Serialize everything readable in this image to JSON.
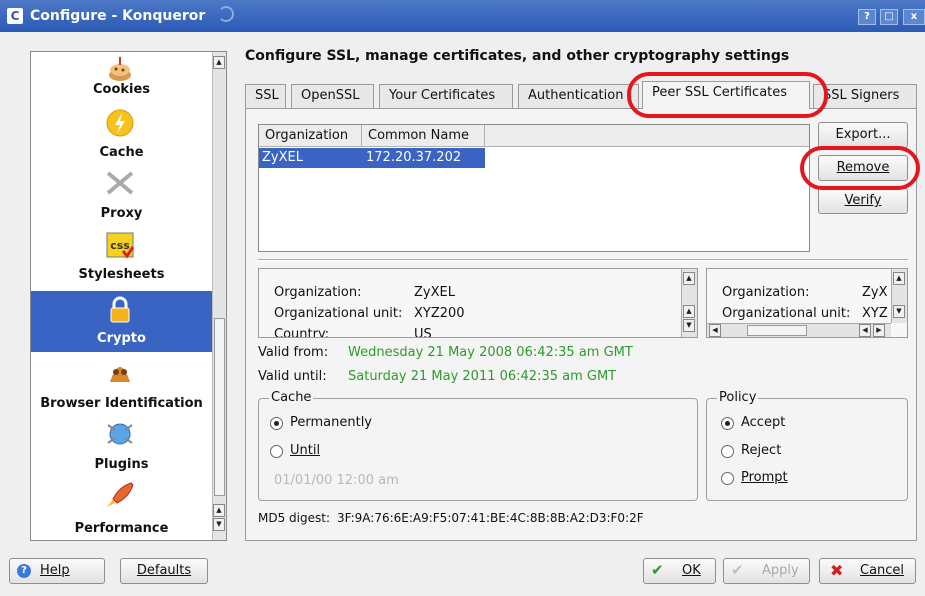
{
  "window": {
    "title": "Configure - Konqueror",
    "app_icon": "C",
    "help_btn": "?",
    "max_btn": "□",
    "close_btn": "x"
  },
  "sidebar": {
    "items": [
      {
        "label": "Cookies",
        "icon": "cookie-icon"
      },
      {
        "label": "Cache",
        "icon": "cache-icon"
      },
      {
        "label": "Proxy",
        "icon": "proxy-icon"
      },
      {
        "label": "Stylesheets",
        "icon": "css-icon"
      },
      {
        "label": "Crypto",
        "icon": "lock-icon",
        "selected": true
      },
      {
        "label": "Browser Identification",
        "icon": "browser-id-icon"
      },
      {
        "label": "Plugins",
        "icon": "plugins-icon"
      },
      {
        "label": "Performance",
        "icon": "rocket-icon"
      }
    ]
  },
  "main": {
    "heading": "Configure SSL, manage certificates, and other cryptography settings",
    "tabs": [
      "SSL",
      "OpenSSL",
      "Your Certificates",
      "Authentication",
      "Peer SSL Certificates",
      "SSL Signers"
    ],
    "list": {
      "columns": [
        "Organization",
        "Common Name"
      ],
      "rows": [
        {
          "organization": "ZyXEL",
          "common_name": "172.20.37.202"
        }
      ]
    },
    "buttons": {
      "export": "Export...",
      "remove": "Remove",
      "verify": "Verify"
    },
    "subject": {
      "org_label": "Organization:",
      "org_value": "ZyXEL",
      "ou_label": "Organizational unit:",
      "ou_value": "XYZ200",
      "country_label": "Country:",
      "country_value": "US"
    },
    "issuer": {
      "org_label": "Organization:",
      "org_value": "ZyX",
      "ou_label": "Organizational unit:",
      "ou_value": "XYZ"
    },
    "valid_from_label": "Valid from:",
    "valid_from": "Wednesday 21 May 2008 06:42:35 am GMT",
    "valid_until_label": "Valid until:",
    "valid_until": "Saturday 21 May 2011 06:42:35 am GMT",
    "cache": {
      "title": "Cache",
      "permanently": "Permanently",
      "until": "Until",
      "until_value": "01/01/00 12:00 am"
    },
    "policy": {
      "title": "Policy",
      "accept": "Accept",
      "reject": "Reject",
      "prompt": "Prompt"
    },
    "md5_label": "MD5 digest:",
    "md5": "3F:9A:76:6E:A9:F5:07:41:BE:4C:8B:8B:A2:D3:F0:2F"
  },
  "footer": {
    "help": "Help",
    "defaults": "Defaults",
    "ok": "OK",
    "apply": "Apply",
    "cancel": "Cancel"
  },
  "colors": {
    "selection": "#3a64c3",
    "annotation": "#e3171d",
    "valid_text": "#2e9a2e"
  }
}
